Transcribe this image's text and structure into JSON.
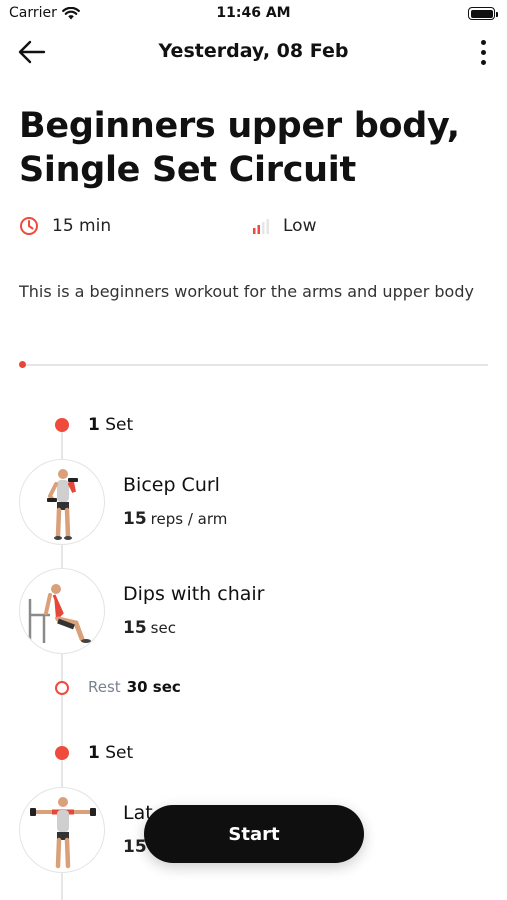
{
  "status_bar": {
    "carrier": "Carrier",
    "time": "11:46 AM",
    "icons": [
      "wifi-icon",
      "battery-icon"
    ]
  },
  "header": {
    "title": "Yesterday, 08 Feb",
    "icons": [
      "back-arrow-icon",
      "more-vertical-icon"
    ]
  },
  "workout": {
    "title_line1": "Beginners upper body,",
    "title_line2": "Single Set Circuit",
    "duration": "15 min",
    "intensity": "Low",
    "description": "This is a beginners workout for the arms and upper body",
    "progress": 0
  },
  "circuits": [
    {
      "set_count": "1",
      "set_label": "Set",
      "exercises": [
        {
          "name": "Bicep Curl",
          "amount": "15",
          "unit": "reps / arm"
        },
        {
          "name": "Dips with chair",
          "amount": "15",
          "unit": "sec"
        }
      ],
      "rest": {
        "label": "Rest",
        "value": "30 sec"
      }
    },
    {
      "set_count": "1",
      "set_label": "Set",
      "exercises": [
        {
          "name": "Lat",
          "amount": "15",
          "unit": ""
        }
      ]
    }
  ],
  "actions": {
    "start_label": "Start"
  },
  "colors": {
    "accent": "#ef4a3b",
    "button": "#0f0f0f"
  }
}
